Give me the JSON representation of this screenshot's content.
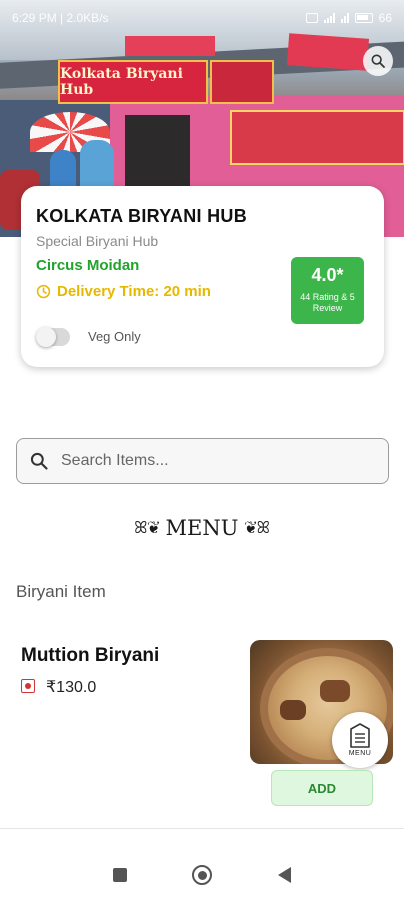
{
  "status_bar": {
    "time": "6:29 PM",
    "network_speed": "2.0KB/s",
    "battery_level": "66"
  },
  "hero": {
    "sign_text": "Kolkata Biryani Hub"
  },
  "restaurant": {
    "name": "KOLKATA BIRYANI HUB",
    "tagline": "Special Biryani Hub",
    "location": "Circus Moidan",
    "delivery_time": "Delivery Time: 20 min",
    "rating_score": "4.0*",
    "rating_count": "44 Rating & 5 Review",
    "veg_only_label": "Veg Only",
    "veg_only_enabled": false
  },
  "search": {
    "placeholder": "Search Items..."
  },
  "menu": {
    "heading": "MENU",
    "flourish_left": "ꕤ❦",
    "flourish_right": "❦ꕤ",
    "category": "Biryani Item",
    "items": [
      {
        "name": "Muttion Biryani",
        "price": "₹130.0",
        "diet": "non-veg",
        "add_label": "ADD"
      }
    ],
    "fab_label": "MENU"
  },
  "colors": {
    "brand_green": "#3cb54a",
    "location_green": "#21a32c",
    "delivery_yellow": "#e6b800",
    "nonveg_red": "#d23434"
  },
  "icons": {
    "search": "search-icon",
    "clock": "clock-icon",
    "menu_book": "menu-book-icon"
  }
}
